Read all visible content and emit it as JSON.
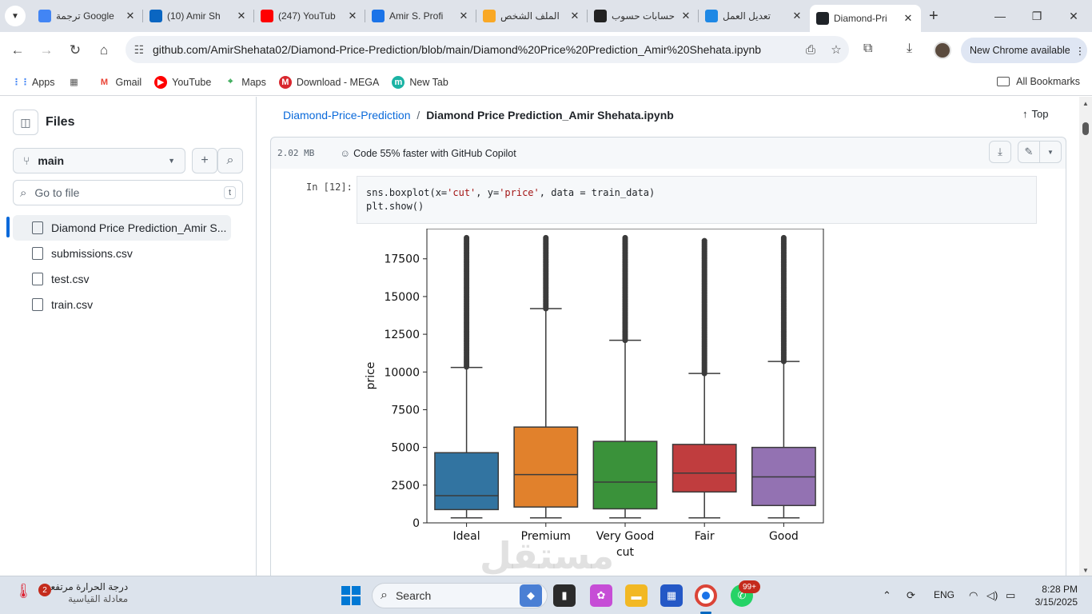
{
  "browser": {
    "tabs": [
      {
        "title": "ترجمة Google",
        "favicon": "google-translate-icon",
        "color": "#4285f4"
      },
      {
        "title": "(10) Amir Sh",
        "favicon": "linkedin-icon",
        "color": "#0a66c2"
      },
      {
        "title": "(247) YouTub",
        "favicon": "youtube-icon",
        "color": "#ff0000"
      },
      {
        "title": "Amir S. Profi",
        "favicon": "upwork-icon",
        "color": "#1a73e8"
      },
      {
        "title": "الملف الشخص",
        "favicon": "mostaql-icon",
        "color": "#f9a825"
      },
      {
        "title": "حسابات حسوب",
        "favicon": "hsoub-icon",
        "color": "#222222"
      },
      {
        "title": "تعديل العمل",
        "favicon": "circle-icon",
        "color": "#1e88e5"
      },
      {
        "title": "Diamond-Pri",
        "favicon": "github-icon",
        "color": "#1f2328",
        "active": true
      }
    ],
    "url": "github.com/AmirShehata02/Diamond-Price-Prediction/blob/main/Diamond%20Price%20Prediction_Amir%20Shehata.ipynb",
    "new_chrome_label": "New Chrome available",
    "bookmarks": [
      {
        "label": "Apps",
        "icon": "apps-grid-icon"
      },
      {
        "label": "",
        "icon": "tab-groups-icon"
      },
      {
        "label": "Gmail",
        "icon": "gmail-icon"
      },
      {
        "label": "YouTube",
        "icon": "youtube-icon"
      },
      {
        "label": "Maps",
        "icon": "maps-icon"
      },
      {
        "label": "Download - MEGA",
        "icon": "mega-icon"
      },
      {
        "label": "New Tab",
        "icon": "new-tab-icon"
      }
    ],
    "all_bookmarks": "All Bookmarks"
  },
  "sidebar": {
    "title": "Files",
    "branch": "main",
    "goto_placeholder": "Go to file",
    "goto_shortcut": "t",
    "files": [
      {
        "name": "Diamond Price Prediction_Amir S...",
        "selected": true
      },
      {
        "name": "submissions.csv"
      },
      {
        "name": "test.csv"
      },
      {
        "name": "train.csv"
      }
    ]
  },
  "file": {
    "repo": "Diamond-Price-Prediction",
    "separator": "/",
    "filename": "Diamond Price Prediction_Amir Shehata.ipynb",
    "top_label": "Top",
    "size": "2.02 MB",
    "copilot": "Code 55% faster with GitHub Copilot"
  },
  "cell": {
    "prompt": "In [12]:",
    "code_line1_pre": "sns.boxplot(x=",
    "code_s1": "'cut'",
    "code_mid1": ", y=",
    "code_s2": "'price'",
    "code_mid2": ", data = train_data)",
    "code_line2": "plt.show()"
  },
  "chart_data": {
    "type": "boxplot",
    "title": "",
    "xlabel": "cut",
    "ylabel": "price",
    "ylim": [
      0,
      19500
    ],
    "yticks": [
      0,
      2500,
      5000,
      7500,
      10000,
      12500,
      15000,
      17500
    ],
    "categories": [
      "Ideal",
      "Premium",
      "Very Good",
      "Fair",
      "Good"
    ],
    "colors": [
      "#3274a1",
      "#e1812c",
      "#3a923a",
      "#c03d3e",
      "#9372b2"
    ],
    "boxes": [
      {
        "min": 330,
        "q1": 880,
        "median": 1800,
        "q3": 4650,
        "whisker_high": 10300,
        "outlier_low": 10300,
        "outlier_high": 18900
      },
      {
        "min": 330,
        "q1": 1050,
        "median": 3200,
        "q3": 6350,
        "whisker_high": 14200,
        "outlier_low": 14200,
        "outlier_high": 18900
      },
      {
        "min": 330,
        "q1": 930,
        "median": 2700,
        "q3": 5400,
        "whisker_high": 12100,
        "outlier_low": 12100,
        "outlier_high": 18900
      },
      {
        "min": 330,
        "q1": 2050,
        "median": 3300,
        "q3": 5200,
        "whisker_high": 9900,
        "outlier_low": 9900,
        "outlier_high": 18700
      },
      {
        "min": 330,
        "q1": 1150,
        "median": 3050,
        "q3": 5000,
        "whisker_high": 10700,
        "outlier_low": 10700,
        "outlier_high": 18900
      }
    ]
  },
  "taskbar": {
    "weather_title": "درجة الحرارة مرتفعـ...",
    "weather_sub": "معادلة القياسية",
    "weather_badge": "2",
    "search_label": "Search",
    "whatsapp_badge": "99+",
    "lang": "ENG",
    "time": "8:28 PM",
    "date": "3/15/2025"
  }
}
